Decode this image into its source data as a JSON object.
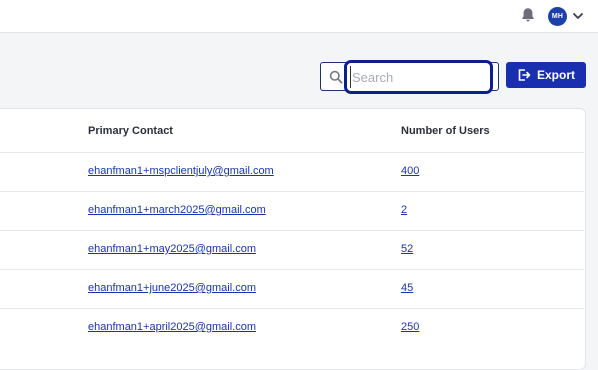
{
  "header": {
    "notifications_icon": "bell-icon",
    "avatar_initials": "MH",
    "avatar_color": "#1d3fa8",
    "menu_icon": "chevron-down-icon"
  },
  "toolbar": {
    "search_placeholder": "Search",
    "search_value": "",
    "export_label": "Export",
    "accent_color": "#1a2fb0"
  },
  "table": {
    "columns": [
      "Primary Contact",
      "Number of Users"
    ],
    "rows": [
      {
        "primary_contact": "ehanfman1+mspclientjuly@gmail.com",
        "number_of_users": "400"
      },
      {
        "primary_contact": "ehanfman1+march2025@gmail.com",
        "number_of_users": "2"
      },
      {
        "primary_contact": "ehanfman1+may2025@gmail.com",
        "number_of_users": "52"
      },
      {
        "primary_contact": "ehanfman1+june2025@gmail.com",
        "number_of_users": "45"
      },
      {
        "primary_contact": "ehanfman1+april2025@gmail.com",
        "number_of_users": "250"
      }
    ]
  }
}
